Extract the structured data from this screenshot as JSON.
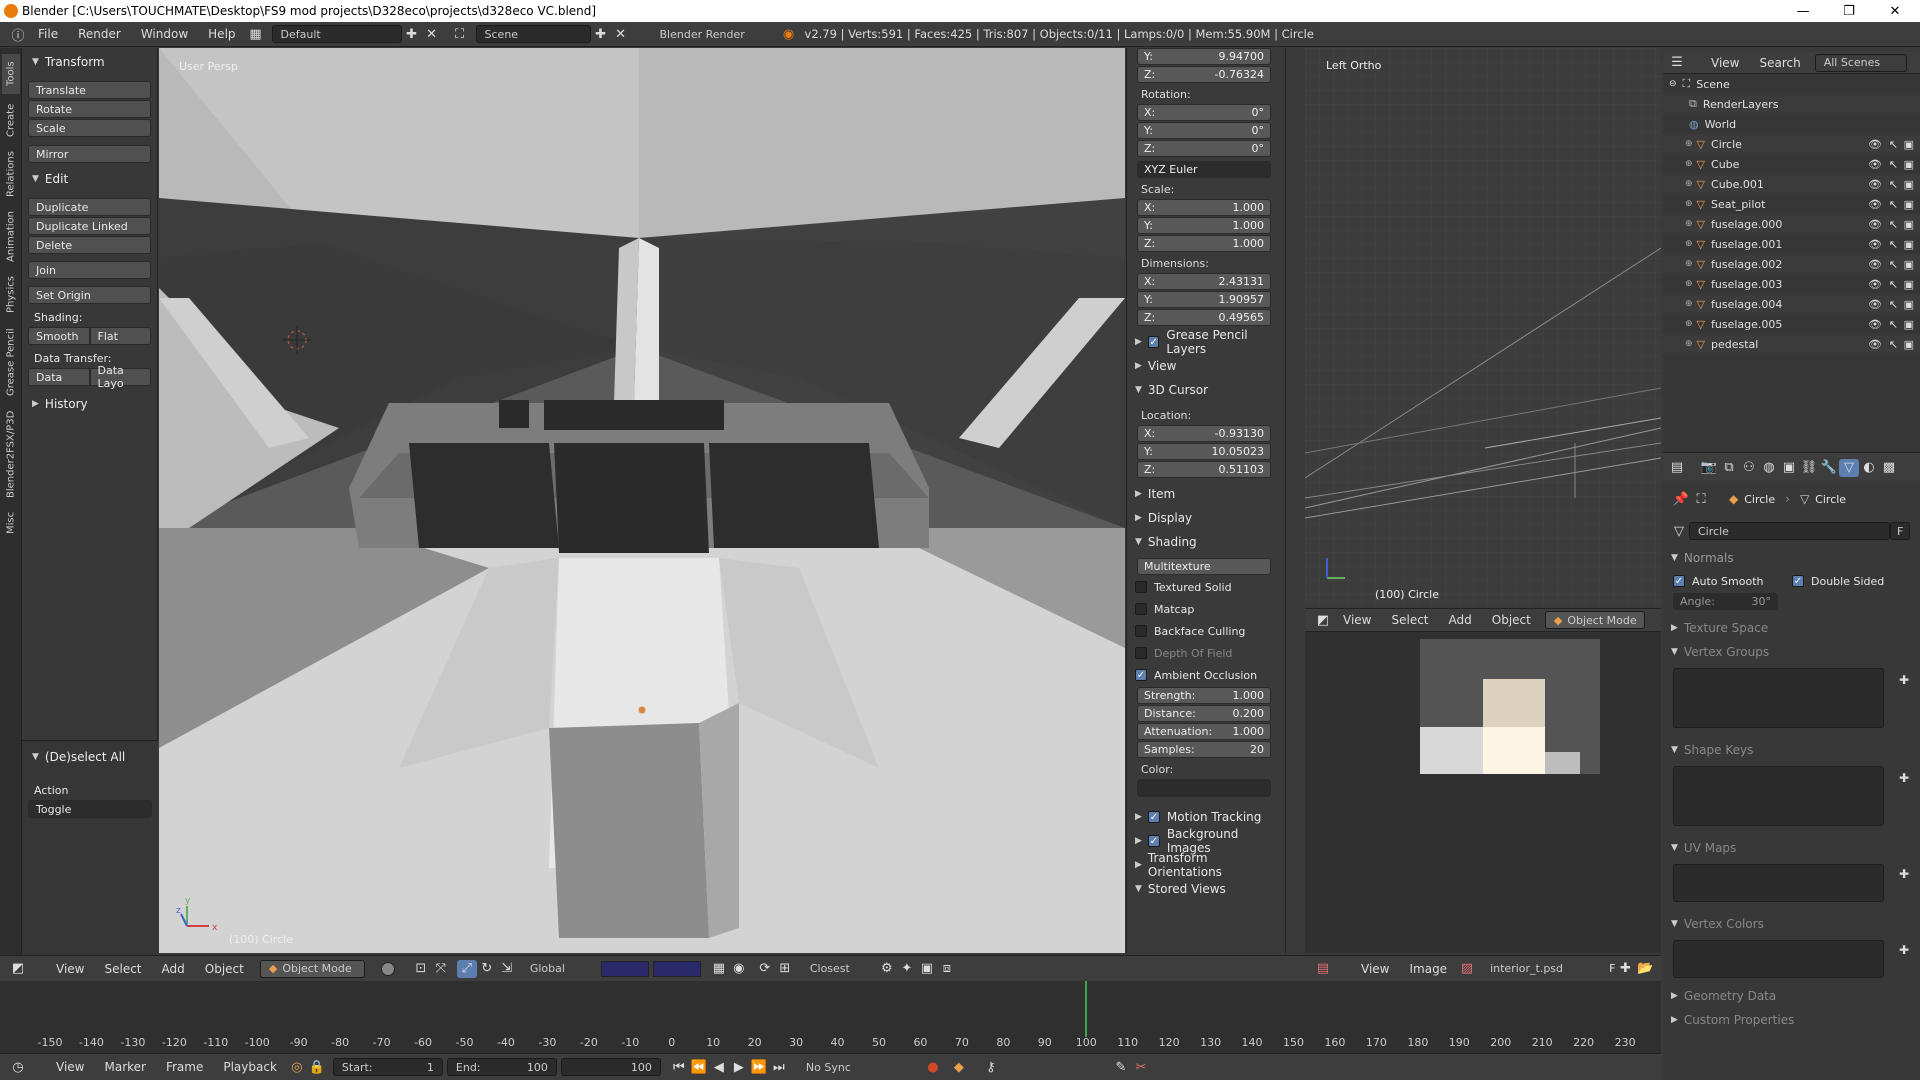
{
  "titlebar": {
    "title": "Blender [C:\\Users\\TOUCHMATE\\Desktop\\FS9 mod projects\\D328eco\\projects\\d328eco VC.blend]",
    "minimize": "—",
    "restore": "❐",
    "close": "✕"
  },
  "infobar": {
    "menus": [
      "File",
      "Render",
      "Window",
      "Help"
    ],
    "layout": "Default",
    "scene": "Scene",
    "engine": "Blender Render",
    "stats": "v2.79 | Verts:591 | Faces:425 | Tris:807 | Objects:0/11 | Lamps:0/0 | Mem:55.90M | Circle"
  },
  "tabs": [
    "Tools",
    "Create",
    "Relations",
    "Animation",
    "Physics",
    "Grease Pencil",
    "Blender2FSX/P3D",
    "Misc"
  ],
  "toolshelf": {
    "transform": "Transform",
    "translate": "Translate",
    "rotate": "Rotate",
    "scale": "Scale",
    "mirror": "Mirror",
    "edit": "Edit",
    "duplicate": "Duplicate",
    "duplicate_linked": "Duplicate Linked",
    "delete": "Delete",
    "join": "Join",
    "set_origin": "Set Origin",
    "shading": "Shading:",
    "smooth": "Smooth",
    "flat": "Flat",
    "data_transfer": "Data Transfer:",
    "data": "Data",
    "data_layo": "Data Layo",
    "history": "History",
    "deselect_all": "(De)select All",
    "action": "Action",
    "toggle": "Toggle"
  },
  "viewport": {
    "persp": "User Persp",
    "object": "(100) Circle"
  },
  "npanel": {
    "loc_y": {
      "label": "Y:",
      "value": "9.94700"
    },
    "loc_z": {
      "label": "Z:",
      "value": "-0.76324"
    },
    "rotation": "Rotation:",
    "rot": [
      {
        "label": "X:",
        "value": "0°"
      },
      {
        "label": "Y:",
        "value": "0°"
      },
      {
        "label": "Z:",
        "value": "0°"
      }
    ],
    "rot_mode": "XYZ Euler",
    "scale": "Scale:",
    "scl": [
      {
        "label": "X:",
        "value": "1.000"
      },
      {
        "label": "Y:",
        "value": "1.000"
      },
      {
        "label": "Z:",
        "value": "1.000"
      }
    ],
    "dimensions": "Dimensions:",
    "dim": [
      {
        "label": "X:",
        "value": "2.43131"
      },
      {
        "label": "Y:",
        "value": "1.90957"
      },
      {
        "label": "Z:",
        "value": "0.49565"
      }
    ],
    "grease": "Grease Pencil Layers",
    "view": "View",
    "cursor": "3D Cursor",
    "location": "Location:",
    "cur": [
      {
        "label": "X:",
        "value": "-0.93130"
      },
      {
        "label": "Y:",
        "value": "10.05023"
      },
      {
        "label": "Z:",
        "value": "0.51103"
      }
    ],
    "item": "Item",
    "display": "Display",
    "shading": "Shading",
    "multitexture": "Multitexture",
    "textured_solid": "Textured Solid",
    "matcap": "Matcap",
    "backface": "Backface Culling",
    "dof": "Depth Of Field",
    "ao": "Ambient Occlusion",
    "ao_fields": [
      {
        "label": "Strength:",
        "value": "1.000"
      },
      {
        "label": "Distance:",
        "value": "0.200"
      },
      {
        "label": "Attenuation:",
        "value": "1.000"
      },
      {
        "label": "Samples:",
        "value": "20"
      }
    ],
    "color": "Color:",
    "motion": "Motion Tracking",
    "bg_images": "Background Images",
    "transform_orient": "Transform Orientations",
    "stored_views": "Stored Views"
  },
  "ortho": {
    "label": "Left Ortho",
    "object": "(100) Circle",
    "menus": [
      "View",
      "Select",
      "Add",
      "Object"
    ],
    "mode": "Object Mode"
  },
  "outliner": {
    "menus": [
      "View",
      "Search"
    ],
    "filter": "All Scenes",
    "scene": "Scene",
    "items": [
      "RenderLayers",
      "World",
      "Circle",
      "Cube",
      "Cube.001",
      "Seat_pilot",
      "fuselage.000",
      "fuselage.001",
      "fuselage.002",
      "fuselage.003",
      "fuselage.004",
      "fuselage.005",
      "pedestal"
    ]
  },
  "props": {
    "crumb_obj": "Circle",
    "crumb_mesh": "Circle",
    "mesh_name": "Circle",
    "fake": "F",
    "normals": "Normals",
    "auto_smooth": "Auto Smooth",
    "double_sided": "Double Sided",
    "angle": "Angle:",
    "angle_value": "30°",
    "texture_space": "Texture Space",
    "vertex_groups": "Vertex Groups",
    "shape_keys": "Shape Keys",
    "uv_maps": "UV Maps",
    "vertex_colors": "Vertex Colors",
    "geometry_data": "Geometry Data",
    "custom_props": "Custom Properties"
  },
  "vphead": {
    "menus": [
      "View",
      "Select",
      "Add",
      "Object"
    ],
    "mode": "Object Mode",
    "orientation": "Global",
    "snap": "Closest"
  },
  "imghead": {
    "menus": [
      "View",
      "Image"
    ],
    "image": "interior_t.psd",
    "fake": "F"
  },
  "timeline": {
    "ticks": [
      "-150",
      "-140",
      "-130",
      "-120",
      "-110",
      "-100",
      "-90",
      "-80",
      "-70",
      "-60",
      "-50",
      "-40",
      "-30",
      "-20",
      "-10",
      "0",
      "10",
      "20",
      "30",
      "40",
      "50",
      "60",
      "70",
      "80",
      "90",
      "100",
      "110",
      "120",
      "130",
      "140",
      "150",
      "160",
      "170",
      "180",
      "190",
      "200",
      "210",
      "220",
      "230"
    ],
    "current": 100,
    "menus": [
      "View",
      "Marker",
      "Frame",
      "Playback"
    ],
    "start_label": "Start:",
    "start": "1",
    "end_label": "End:",
    "end": "100",
    "frame": "100",
    "sync": "No Sync"
  },
  "colors": {
    "accent": "#5d7fb0",
    "frame_line": "#3ba552",
    "cursor": "#d9673a"
  }
}
